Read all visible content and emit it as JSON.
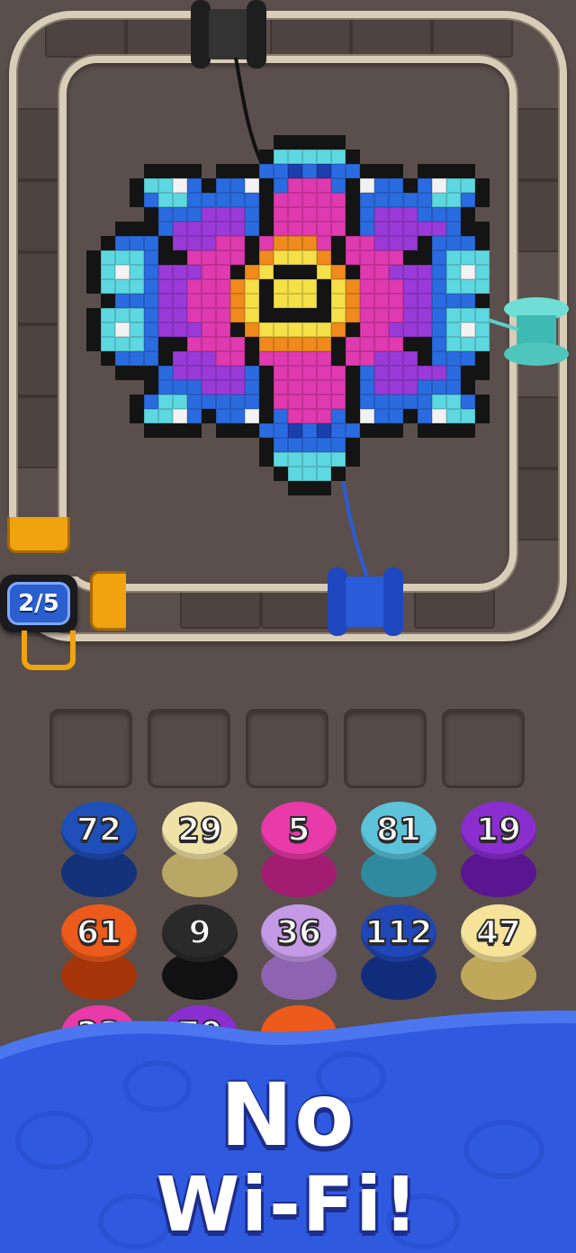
{
  "level_progress": "2/5",
  "slots_count": 5,
  "spools": [
    {
      "number": "72",
      "color": "#1f4fb8",
      "dark": "#13327a"
    },
    {
      "number": "29",
      "color": "#efe2a8",
      "dark": "#b9a765"
    },
    {
      "number": "5",
      "color": "#e83aa8",
      "dark": "#a21d72"
    },
    {
      "number": "81",
      "color": "#5cc3da",
      "dark": "#2f8aa0"
    },
    {
      "number": "19",
      "color": "#8a2ed0",
      "dark": "#5a1690"
    },
    {
      "number": "61",
      "color": "#ec5a1c",
      "dark": "#a53409"
    },
    {
      "number": "9",
      "color": "#2a2a2a",
      "dark": "#111111"
    },
    {
      "number": "36",
      "color": "#c49ae6",
      "dark": "#8d63b2"
    },
    {
      "number": "112",
      "color": "#2047b8",
      "dark": "#122c7c"
    },
    {
      "number": "47",
      "color": "#f5e39a",
      "dark": "#c0a85a"
    },
    {
      "number": "23",
      "color": "#e83aa8",
      "dark": "#a21d72"
    },
    {
      "number": "70",
      "color": "#8a2ed0",
      "dark": "#5a1690"
    },
    {
      "number": "",
      "color": "#ec5a1c",
      "dark": "#a53409"
    }
  ],
  "rail_spools": [
    {
      "name": "black",
      "color": "#2a2a2a"
    },
    {
      "name": "teal",
      "color": "#5cd0c8"
    },
    {
      "name": "blue",
      "color": "#2a5bd8"
    }
  ],
  "banner": {
    "title": "No",
    "subtitle": "Wi-Fi!",
    "background_color": "#2f5ae0"
  },
  "embroidery": {
    "palette": {
      "0": "transparent",
      "K": "#141414",
      "B": "#2b6be0",
      "D": "#1c3fae",
      "T": "#5ed8e0",
      "P": "#e03ab0",
      "V": "#9a3ad8",
      "Y": "#f5e048",
      "O": "#f08a1c",
      "W": "#f2f2f2"
    },
    "rows": [
      "0000000000000KKKKK0000000000",
      "000000000000KTTTTTK000000000",
      "0000KKKK0KKKBBDBDBBKKK0KKKK0",
      "000KTTWBKBBWKBPPPBKWBBKBWTTK",
      "000KBTTBBBBBKPPPPPKBBBBBTTBK",
      "0000KBBBVVVBKPPPPPKBVVVBBBK0",
      "00KKKBVVVVVBKPPPPPKBVVVVVBKKK",
      "0KBBBKVVVPPKPOOOPKPPVVVKBBBK",
      "KTTTBKKPPPPKOYYYOKPPPPKKBTTTK",
      "KTWTBVVVPPKOYKKKYOKPPVVVBTWTK",
      "KTTTBVVPPPOYKYYYKYOPPPVVBTTTK",
      "0KBBBVVPPPOYKYYYKYOPPPVVBBBK",
      "KTTTBVVPPPOYKKKKKYOPPPVVBTTTK",
      "KTWTBVVVPPKOYYYYYOKPPVVVBTWTK",
      "KTTTBKKPPPPKOOOOOKPPPPKKBTTTK",
      "0KBBBKVVVPPKPPPPPKPPVVVKBBBK",
      "00KKKBVVVVVBKPPPPPKBVVVVVBKKK",
      "0000KBBBVVVBKPPPPPKBVVVBBBK0",
      "000KBTTBBBBBKPPPPPKBBBBBTTBK",
      "000KTTWBKBBWKBPPPBKWBBKBWTTK",
      "0000KKKK0KKKBBDBDBBKKK0KKKK0",
      "000000000000KBBBBBK000000000",
      "000000000000KTTTTTK000000000",
      "0000000000000KTTTK0000000000",
      "00000000000000KKK00000000000",
      "0000000000000000000000000000"
    ]
  }
}
